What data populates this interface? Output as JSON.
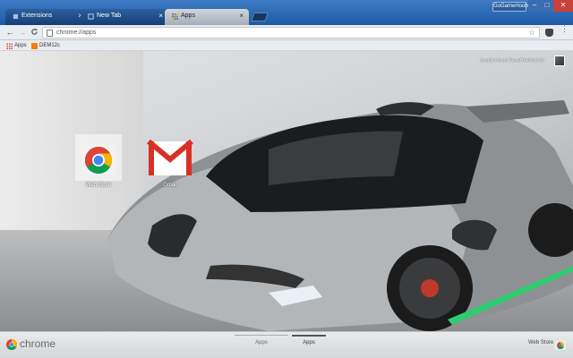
{
  "window": {
    "profile_name": "GoGameHoob",
    "controls": {
      "minimize": "–",
      "maximize": "□",
      "close": "✕"
    }
  },
  "tabs": [
    {
      "label": "Extensions",
      "icon": "extension-icon",
      "active": false
    },
    {
      "label": "New Tab",
      "icon": "newtab-icon",
      "active": false
    },
    {
      "label": "Apps",
      "icon": "apps-grid-icon",
      "active": true
    }
  ],
  "toolbar": {
    "back": "←",
    "forward": "→",
    "reload": "C",
    "address": "chrome://apps",
    "star": "☆",
    "menu": "⋮"
  },
  "bookmarks": [
    {
      "label": "Apps",
      "icon": "apps-grid-icon"
    },
    {
      "label": "DEM12c",
      "icon": "blogger-icon"
    }
  ],
  "content": {
    "photo_credit": "SouldierMoon  PawelTheWonder",
    "apps": [
      {
        "name": "Web Store",
        "icon": "chrome-webstore-icon"
      },
      {
        "name": "Gmail",
        "icon": "gmail-icon"
      }
    ]
  },
  "bottombar": {
    "brand": "chrome",
    "pages": [
      {
        "label": "Apps",
        "active": false
      },
      {
        "label": "Apps",
        "active": true
      }
    ],
    "webstore_link": "Web Store"
  },
  "colors": {
    "titlebar": "#1d5aa5",
    "gmail_red": "#d93025",
    "chrome_red": "#db4437",
    "chrome_yellow": "#f4b400",
    "chrome_green": "#0f9d58",
    "chrome_blue": "#4285f4"
  }
}
